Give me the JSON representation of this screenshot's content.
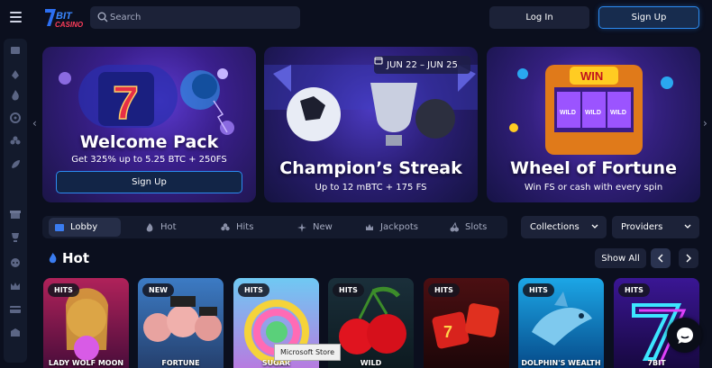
{
  "header": {
    "logo_text": "7BIT CASINO",
    "search_placeholder": "Search",
    "login_label": "Log In",
    "signup_label": "Sign Up"
  },
  "sidebar": {
    "icons": [
      "lobby-icon",
      "poker-icon",
      "fire-icon",
      "roulette-icon",
      "clover-icon",
      "rocket-icon",
      "gift-icon",
      "trophy-icon",
      "tournament-icon",
      "crown-icon",
      "card-icon",
      "vip-icon"
    ]
  },
  "banners": [
    {
      "title": "Welcome Pack",
      "subtitle": "Get 325% up to 5.25 BTC + 250FS",
      "button": "Sign Up"
    },
    {
      "title": "Champion’s Streak",
      "subtitle": "Up to 12 mBTC + 175 FS",
      "date": "JUN 22 – JUN 25"
    },
    {
      "title": "Wheel of Fortune",
      "subtitle": "Win FS or cash with every spin",
      "win_label": "WIN",
      "wild_label": "WILD"
    }
  ],
  "tabs": [
    {
      "label": "Lobby",
      "icon": "lobby-icon",
      "active": true
    },
    {
      "label": "Hot",
      "icon": "fire-icon"
    },
    {
      "label": "Hits",
      "icon": "clover-icon"
    },
    {
      "label": "New",
      "icon": "sparkle-icon"
    },
    {
      "label": "Jackpots",
      "icon": "jackpot-icon"
    },
    {
      "label": "Slots",
      "icon": "cherry-icon"
    }
  ],
  "dropdowns": {
    "collections": "Collections",
    "providers": "Providers"
  },
  "section": {
    "title": "Hot",
    "show_all": "Show All"
  },
  "games": [
    {
      "badge": "HITS",
      "name": "LADY WOLF MOON"
    },
    {
      "badge": "NEW",
      "name": "FORTUNE"
    },
    {
      "badge": "HITS",
      "name": "SUGAR"
    },
    {
      "badge": "HITS",
      "name": "WILD"
    },
    {
      "badge": "HITS",
      "name": ""
    },
    {
      "badge": "HITS",
      "name": "DOLPHIN'S WEALTH"
    },
    {
      "badge": "HITS",
      "name": "7BIT"
    }
  ],
  "tooltip": "Microsoft Store",
  "colors": {
    "background": "#0b0f1e",
    "accent": "#2c8cf2",
    "panel": "#1c2238"
  }
}
